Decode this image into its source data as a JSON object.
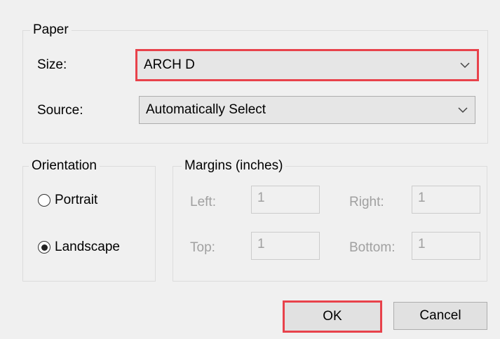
{
  "paper": {
    "title": "Paper",
    "size_label": "Size:",
    "size_value": "ARCH D",
    "source_label": "Source:",
    "source_value": "Automatically Select"
  },
  "orientation": {
    "title": "Orientation",
    "portrait_label": "Portrait",
    "landscape_label": "Landscape",
    "selected": "Landscape"
  },
  "margins": {
    "title": "Margins (inches)",
    "left_label": "Left:",
    "left_value": "1",
    "right_label": "Right:",
    "right_value": "1",
    "top_label": "Top:",
    "top_value": "1",
    "bottom_label": "Bottom:",
    "bottom_value": "1"
  },
  "buttons": {
    "ok_label": "OK",
    "cancel_label": "Cancel"
  },
  "colors": {
    "highlight": "#e8424b"
  }
}
